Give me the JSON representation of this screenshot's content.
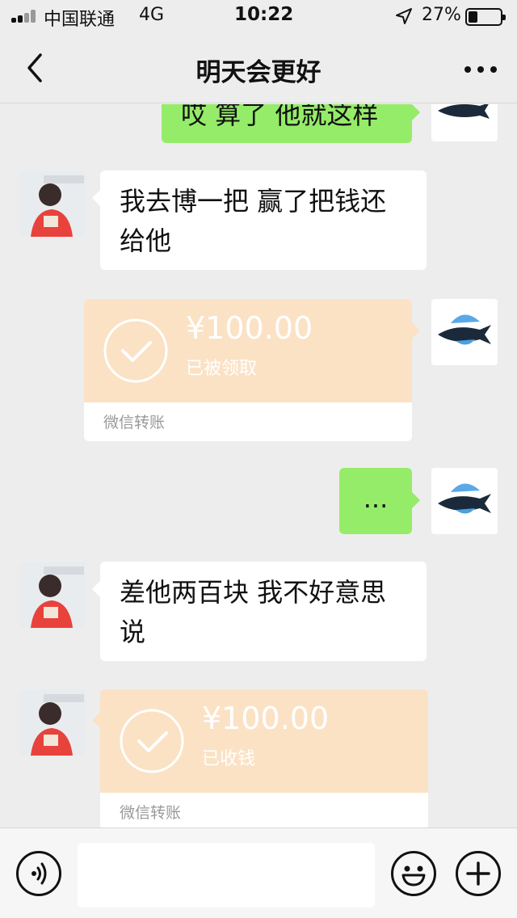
{
  "status_bar": {
    "carrier": "中国联通",
    "network": "4G",
    "time": "10:22",
    "battery_percent": "27%",
    "battery_level": 0.27
  },
  "nav": {
    "back_icon": "chevron-left-icon",
    "title": "明天会更好",
    "more_icon": "more-dots-icon"
  },
  "chat": {
    "messages": [
      {
        "side": "right",
        "type": "text",
        "text": "哎 算了 他就这样",
        "partially_visible": true
      },
      {
        "side": "left",
        "type": "text",
        "text": "我去博一把 赢了把钱还给他"
      },
      {
        "side": "right",
        "type": "transfer",
        "amount": "¥100.00",
        "status": "已被领取",
        "label": "微信转账"
      },
      {
        "side": "right",
        "type": "text",
        "text": "..."
      },
      {
        "side": "left",
        "type": "text",
        "text": "差他两百块 我不好意思说"
      },
      {
        "side": "left",
        "type": "transfer",
        "amount": "¥100.00",
        "status": "已收钱",
        "label": "微信转账"
      }
    ]
  },
  "input_bar": {
    "voice_icon": "voice-icon",
    "emoji_icon": "emoji-icon",
    "plus_icon": "plus-icon"
  },
  "colors": {
    "background": "#ededed",
    "sent_bubble": "#95ec69",
    "received_bubble": "#ffffff",
    "transfer_card": "#fbe2c5"
  }
}
